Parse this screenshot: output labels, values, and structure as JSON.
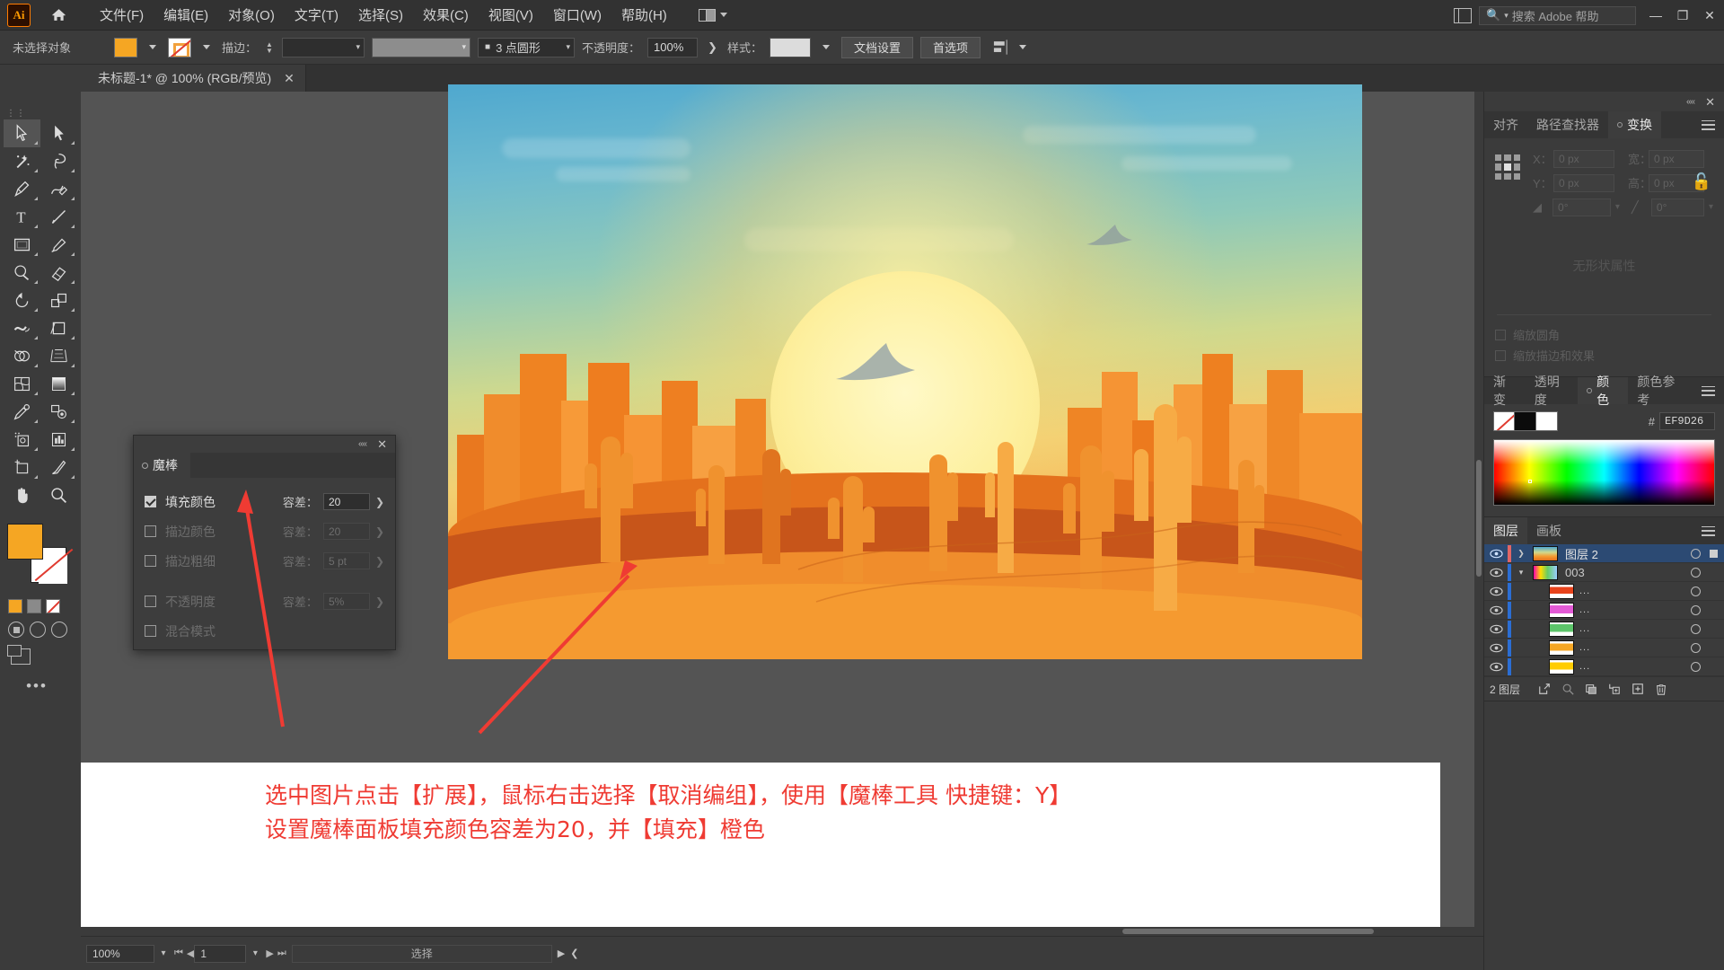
{
  "app": {
    "name": "Ai",
    "home_icon": "home-icon",
    "arrange_icon": "arrange-documents-icon"
  },
  "menubar": {
    "items": [
      {
        "label": "文件(F)",
        "name": "menu-file"
      },
      {
        "label": "编辑(E)",
        "name": "menu-edit"
      },
      {
        "label": "对象(O)",
        "name": "menu-object"
      },
      {
        "label": "文字(T)",
        "name": "menu-type"
      },
      {
        "label": "选择(S)",
        "name": "menu-select"
      },
      {
        "label": "效果(C)",
        "name": "menu-effect"
      },
      {
        "label": "视图(V)",
        "name": "menu-view"
      },
      {
        "label": "窗口(W)",
        "name": "menu-window"
      },
      {
        "label": "帮助(H)",
        "name": "menu-help"
      }
    ],
    "search_placeholder": "搜索 Adobe 帮助",
    "window_minimize": "—",
    "window_restore": "❐",
    "window_close": "✕"
  },
  "controlbar": {
    "selection_status": "未选择对象",
    "fill_color": "#F5A623",
    "stroke_label": "描边：",
    "stroke_weight": "",
    "profile_label": "3 点圆形",
    "opacity_label": "不透明度：",
    "opacity_value": "100%",
    "style_label": "样式：",
    "doc_setup_button": "文档设置",
    "preferences_button": "首选项"
  },
  "documenttab": {
    "title": "未标题-1* @ 100% (RGB/预览)",
    "close": "✕"
  },
  "toolbar": {
    "tools": [
      {
        "name": "selection-tool",
        "active": true
      },
      {
        "name": "direct-selection-tool",
        "active": false
      },
      {
        "name": "magic-wand-tool",
        "active": false
      },
      {
        "name": "lasso-tool",
        "active": false
      },
      {
        "name": "pen-tool",
        "active": false
      },
      {
        "name": "curvature-tool",
        "active": false
      },
      {
        "name": "type-tool",
        "active": false
      },
      {
        "name": "line-segment-tool",
        "active": false
      },
      {
        "name": "rectangle-tool",
        "active": false
      },
      {
        "name": "paintbrush-tool",
        "active": false
      },
      {
        "name": "shaper-tool",
        "active": false
      },
      {
        "name": "eraser-tool",
        "active": false
      },
      {
        "name": "rotate-tool",
        "active": false
      },
      {
        "name": "scale-tool",
        "active": false
      },
      {
        "name": "width-tool",
        "active": false
      },
      {
        "name": "free-transform-tool",
        "active": false
      },
      {
        "name": "shape-builder-tool",
        "active": false
      },
      {
        "name": "perspective-grid-tool",
        "active": false
      },
      {
        "name": "mesh-tool",
        "active": false
      },
      {
        "name": "gradient-tool",
        "active": false
      },
      {
        "name": "eyedropper-tool",
        "active": false
      },
      {
        "name": "blend-tool",
        "active": false
      },
      {
        "name": "symbol-sprayer-tool",
        "active": false
      },
      {
        "name": "column-graph-tool",
        "active": false
      },
      {
        "name": "artboard-tool",
        "active": false
      },
      {
        "name": "slice-tool",
        "active": false
      },
      {
        "name": "hand-tool",
        "active": false
      },
      {
        "name": "zoom-tool",
        "active": false
      }
    ],
    "fill_color": "#F5A623",
    "stroke_color": "#FFFFFF",
    "more_tools": "•••"
  },
  "magic_wand_panel": {
    "tab_label": "魔棒",
    "close": "✕",
    "dock": "««",
    "rows": [
      {
        "label": "填充颜色",
        "checked": true,
        "tolerance_label": "容差：",
        "tolerance_value": "20",
        "enabled": true
      },
      {
        "label": "描边颜色",
        "checked": false,
        "tolerance_label": "容差：",
        "tolerance_value": "20",
        "enabled": false
      },
      {
        "label": "描边粗细",
        "checked": false,
        "tolerance_label": "容差：",
        "tolerance_value": "5 pt",
        "enabled": false
      },
      {
        "label": "不透明度",
        "checked": false,
        "tolerance_label": "容差：",
        "tolerance_value": "5%",
        "enabled": false
      },
      {
        "label": "混合模式",
        "checked": false,
        "tolerance_label": "",
        "tolerance_value": "",
        "enabled": false
      }
    ]
  },
  "transform_panel": {
    "tabs": [
      {
        "label": "对齐",
        "active": false
      },
      {
        "label": "路径查找器",
        "active": false
      },
      {
        "label": "变换",
        "active": true
      }
    ],
    "x_label": "X：",
    "x_value": "0 px",
    "y_label": "Y：",
    "y_value": "0 px",
    "w_label": "宽：",
    "w_value": "0 px",
    "h_label": "高：",
    "h_value": "0 px",
    "angle_value": "0°",
    "shear_value": "0°",
    "empty_text": "无形状属性",
    "scale_corners": "缩放圆角",
    "scale_strokes": "缩放描边和效果"
  },
  "color_panel": {
    "tabs": [
      {
        "label": "渐变",
        "active": false
      },
      {
        "label": "透明度",
        "active": false
      },
      {
        "label": "颜色",
        "active": true
      },
      {
        "label": "颜色参考",
        "active": false
      }
    ],
    "hash": "#",
    "hex_value": "EF9D26",
    "swatch_none": "none-swatch",
    "swatch_black": "#000000",
    "swatch_white": "#FFFFFF"
  },
  "layers_panel": {
    "tabs": [
      {
        "label": "图层",
        "active": true
      },
      {
        "label": "画板",
        "active": false
      }
    ],
    "rows": [
      {
        "name": "图层 2",
        "selected": true,
        "expanded": false,
        "color": "#E06666",
        "thumb": "sunset",
        "indent": 0
      },
      {
        "name": "003",
        "selected": false,
        "expanded": true,
        "color": "#2B6ED4",
        "thumb": "multi",
        "indent": 1
      },
      {
        "name": "...",
        "selected": false,
        "expanded": null,
        "color": "#2B6ED4",
        "thumb": "orange-red",
        "indent": 2
      },
      {
        "name": "...",
        "selected": false,
        "expanded": null,
        "color": "#2B6ED4",
        "thumb": "magenta",
        "indent": 2
      },
      {
        "name": "...",
        "selected": false,
        "expanded": null,
        "color": "#2B6ED4",
        "thumb": "green",
        "indent": 2
      },
      {
        "name": "...",
        "selected": false,
        "expanded": null,
        "color": "#2B6ED4",
        "thumb": "orange",
        "indent": 2
      },
      {
        "name": "...",
        "selected": false,
        "expanded": null,
        "color": "#2B6ED4",
        "thumb": "yellow",
        "indent": 2
      }
    ],
    "footer_count": "2 图层",
    "footer_icons": [
      "locate-object-icon",
      "find-icon",
      "make-clipping-mask-icon",
      "create-sublayer-icon",
      "create-new-layer-icon",
      "delete-layer-icon"
    ]
  },
  "statusbar": {
    "zoom": "100%",
    "page": "1",
    "tool_status": "选择"
  },
  "annotation": {
    "line1": "选中图片点击【扩展】，鼠标右击选择【取消编组】，使用【魔棒工具 快捷键：Y】",
    "line2": "设置魔棒面板填充颜色容差为20，并【填充】橙色",
    "color": "#EF3B33"
  },
  "artwork": {
    "description": "desert-sunset-illustration",
    "sun_color": "#FDF0A0",
    "sand_color": "#F59A30",
    "cactus_color": "#F0922E"
  }
}
